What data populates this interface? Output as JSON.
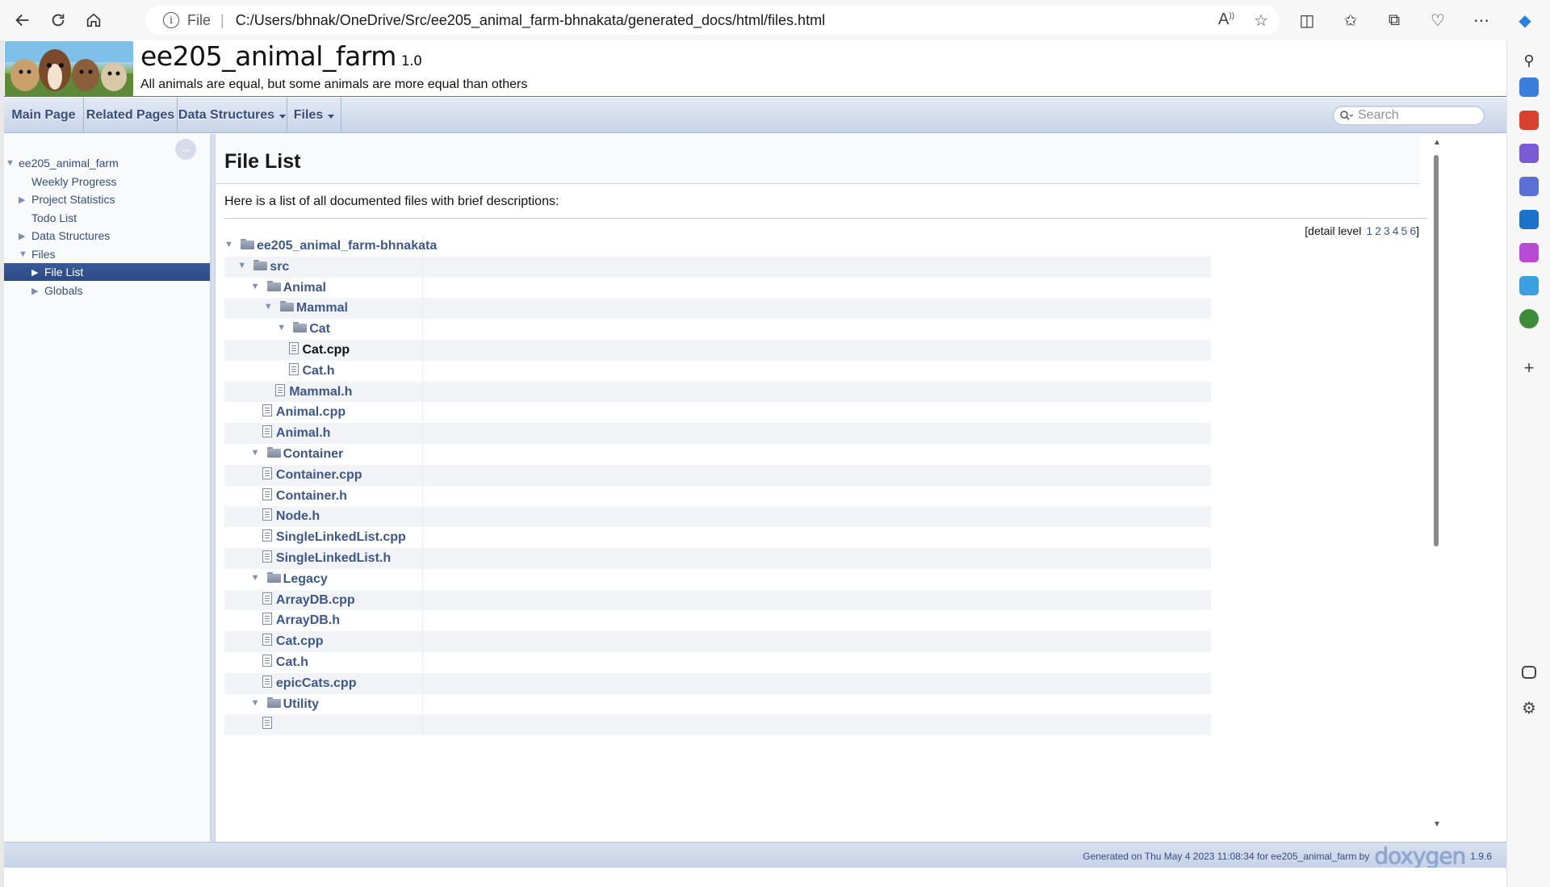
{
  "browser": {
    "address_label": "File",
    "url": "C:/Users/bhnak/OneDrive/Src/ee205_animal_farm-bhnakata/generated_docs/html/files.html"
  },
  "project": {
    "name": "ee205_animal_farm",
    "number": "1.0",
    "brief": "All animals are equal, but some animals are more equal than others"
  },
  "menu": {
    "main_page": "Main Page",
    "related_pages": "Related Pages",
    "data_structures": "Data Structures",
    "files": "Files",
    "search_placeholder": "Search"
  },
  "side_nav": {
    "items": [
      {
        "label": "ee205_animal_farm",
        "arrow": "▼"
      },
      {
        "label": "Weekly Progress",
        "arrow": ""
      },
      {
        "label": "Project Statistics",
        "arrow": "▶"
      },
      {
        "label": "Todo List",
        "arrow": ""
      },
      {
        "label": "Data Structures",
        "arrow": "▶"
      },
      {
        "label": "Files",
        "arrow": "▼"
      },
      {
        "label": "File List",
        "arrow": "▶"
      },
      {
        "label": "Globals",
        "arrow": "▶"
      }
    ]
  },
  "content": {
    "title": "File List",
    "intro": "Here is a list of all documented files with brief descriptions:",
    "detail_level_label": "[detail level",
    "detail_levels": [
      "1",
      "2",
      "3",
      "4",
      "5",
      "6"
    ],
    "detail_close": "]"
  },
  "file_tree": [
    {
      "name": "ee205_animal_farm-bhnakata",
      "type": "folder",
      "depth": 0,
      "expanded": true
    },
    {
      "name": "src",
      "type": "folder",
      "depth": 1,
      "expanded": true
    },
    {
      "name": "Animal",
      "type": "folder",
      "depth": 2,
      "expanded": true
    },
    {
      "name": "Mammal",
      "type": "folder",
      "depth": 3,
      "expanded": true
    },
    {
      "name": "Cat",
      "type": "folder",
      "depth": 4,
      "expanded": true
    },
    {
      "name": "Cat.cpp",
      "type": "file",
      "depth": 5,
      "visited": true
    },
    {
      "name": "Cat.h",
      "type": "file",
      "depth": 5
    },
    {
      "name": "Mammal.h",
      "type": "file",
      "depth": 4
    },
    {
      "name": "Animal.cpp",
      "type": "file",
      "depth": 3
    },
    {
      "name": "Animal.h",
      "type": "file",
      "depth": 3
    },
    {
      "name": "Container",
      "type": "folder",
      "depth": 2,
      "expanded": true
    },
    {
      "name": "Container.cpp",
      "type": "file",
      "depth": 3
    },
    {
      "name": "Container.h",
      "type": "file",
      "depth": 3
    },
    {
      "name": "Node.h",
      "type": "file",
      "depth": 3
    },
    {
      "name": "SingleLinkedList.cpp",
      "type": "file",
      "depth": 3
    },
    {
      "name": "SingleLinkedList.h",
      "type": "file",
      "depth": 3
    },
    {
      "name": "Legacy",
      "type": "folder",
      "depth": 2,
      "expanded": true
    },
    {
      "name": "ArrayDB.cpp",
      "type": "file",
      "depth": 3
    },
    {
      "name": "ArrayDB.h",
      "type": "file",
      "depth": 3
    },
    {
      "name": "Cat.cpp",
      "type": "file",
      "depth": 3
    },
    {
      "name": "Cat.h",
      "type": "file",
      "depth": 3
    },
    {
      "name": "epicCats.cpp",
      "type": "file",
      "depth": 3
    },
    {
      "name": "Utility",
      "type": "folder",
      "depth": 2,
      "expanded": true
    },
    {
      "name": "",
      "type": "file",
      "depth": 3
    }
  ],
  "footer": {
    "generated": "Generated on Thu May 4 2023 11:08:34 for ee205_animal_farm by",
    "logo_text": "doxygen",
    "version": "1.9.6"
  },
  "colors": {
    "link": "#3d578c",
    "nav_text": "#364d7c",
    "selected_bg": "#2c4a84"
  }
}
